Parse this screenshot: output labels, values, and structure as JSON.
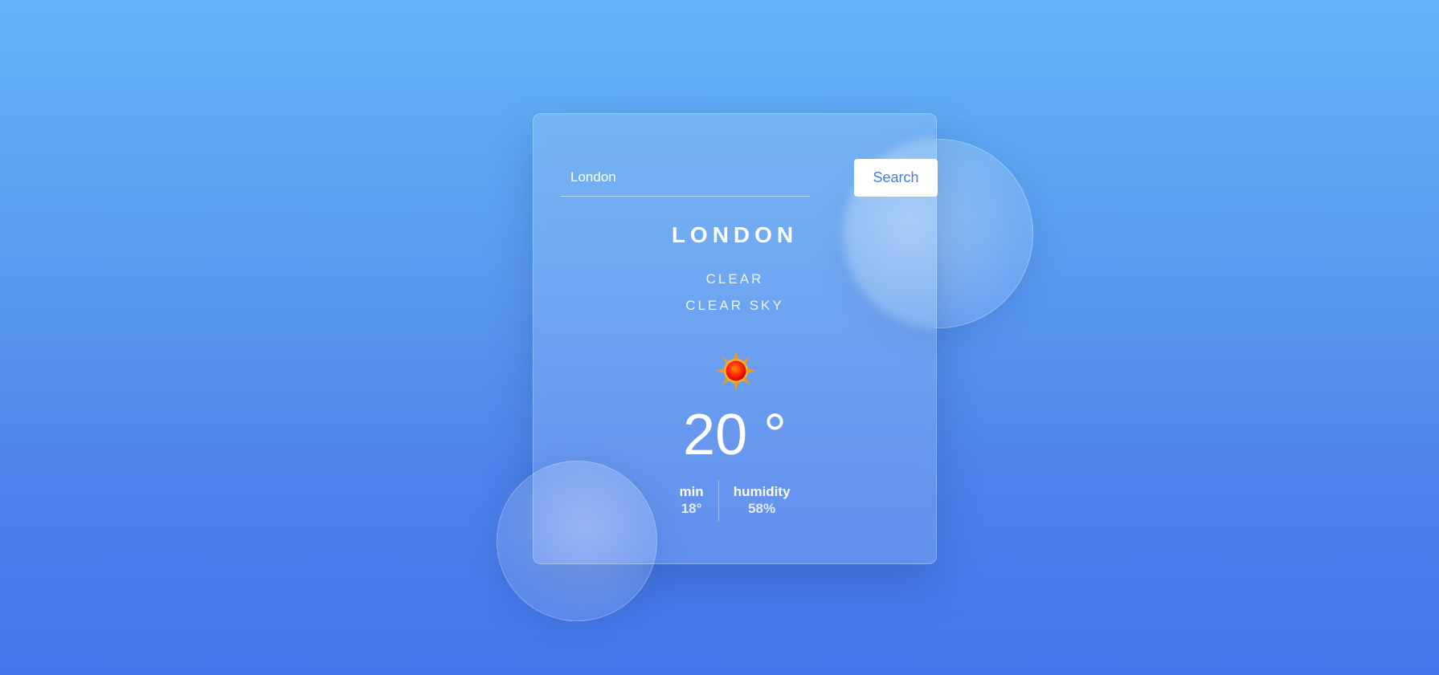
{
  "search": {
    "value": "London",
    "button_label": "Search"
  },
  "weather": {
    "city": "LONDON",
    "condition": "CLEAR",
    "description": "CLEAR SKY",
    "icon": "sun-icon",
    "temperature": "20 °"
  },
  "stats": {
    "min_label": "min",
    "min_value": "18°",
    "humidity_label": "humidity",
    "humidity_value": "58%"
  },
  "colors": {
    "accent": "#4a7ae6",
    "background_top": "#63b4f6",
    "background_bottom": "#4577ec"
  }
}
